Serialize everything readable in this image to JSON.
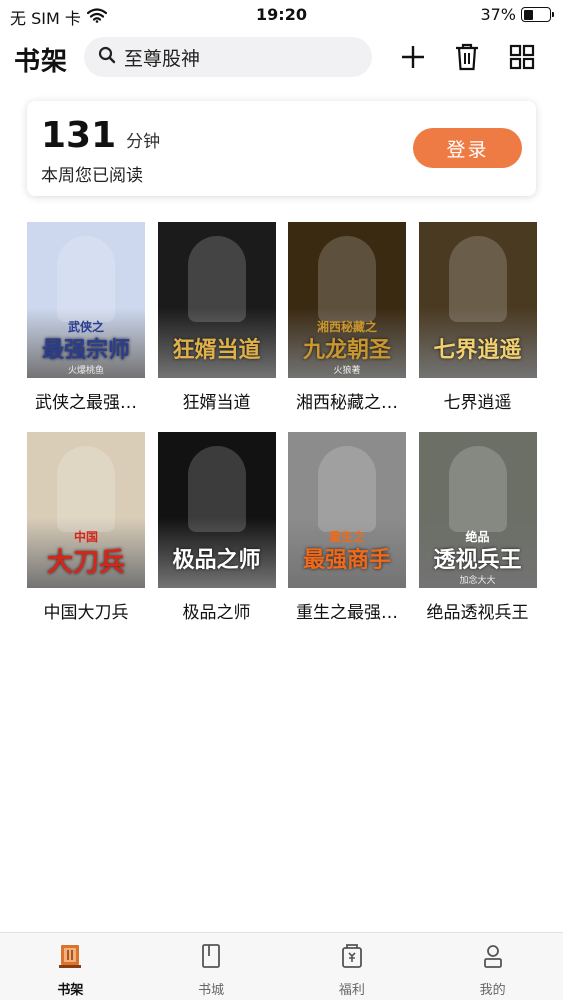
{
  "status_bar": {
    "carrier": "无 SIM 卡",
    "time": "19:20",
    "battery_percent": "37%",
    "battery_level": 0.37
  },
  "header": {
    "title": "书架",
    "search_text": "至尊股神",
    "icons": [
      "search-icon",
      "add-icon",
      "trash-icon",
      "grid-icon"
    ]
  },
  "reading_card": {
    "minutes": "131",
    "unit": "分钟",
    "description": "本周您已阅读",
    "login_label": "登录"
  },
  "books": [
    {
      "name": "武侠之最强…",
      "cover_title": "最强宗师",
      "cover_sub": "武侠之",
      "cover_author": "火爆桃鱼",
      "bg": "#cdd8ef",
      "accent": "#2b3d8f"
    },
    {
      "name": "狂婿当道",
      "cover_title": "狂婿当道",
      "cover_sub": "",
      "cover_author": "",
      "bg": "#1b1b1b",
      "accent": "#e0b14a"
    },
    {
      "name": "湘西秘藏之…",
      "cover_title": "九龙朝圣",
      "cover_sub": "湘西秘藏之",
      "cover_author": "火狼著",
      "bg": "#3a2a12",
      "accent": "#c9962f"
    },
    {
      "name": "七界逍遥",
      "cover_title": "七界逍遥",
      "cover_sub": "",
      "cover_author": "",
      "bg": "#4a3a22",
      "accent": "#f0d070"
    },
    {
      "name": "中国大刀兵",
      "cover_title": "大刀兵",
      "cover_sub": "中国",
      "cover_author": "",
      "bg": "#d9cdb8",
      "accent": "#d6261c"
    },
    {
      "name": "极品之师",
      "cover_title": "极品之师",
      "cover_sub": "",
      "cover_author": "",
      "bg": "#121212",
      "accent": "#ffffff"
    },
    {
      "name": "重生之最强…",
      "cover_title": "最强商手",
      "cover_sub": "重生之",
      "cover_author": "",
      "bg": "#8c8c8c",
      "accent": "#f06a1a"
    },
    {
      "name": "绝品透视兵王",
      "cover_title": "透视兵王",
      "cover_sub": "绝品",
      "cover_author": "加念大大",
      "bg": "#6b6f66",
      "accent": "#ffffff"
    }
  ],
  "tabs": [
    {
      "label": "书架",
      "icon": "bookshelf-icon",
      "active": true
    },
    {
      "label": "书城",
      "icon": "bookstore-icon",
      "active": false
    },
    {
      "label": "福利",
      "icon": "welfare-icon",
      "active": false
    },
    {
      "label": "我的",
      "icon": "profile-icon",
      "active": false
    }
  ],
  "colors": {
    "accent": "#ee7a44",
    "active_tab": "#d9742e"
  }
}
